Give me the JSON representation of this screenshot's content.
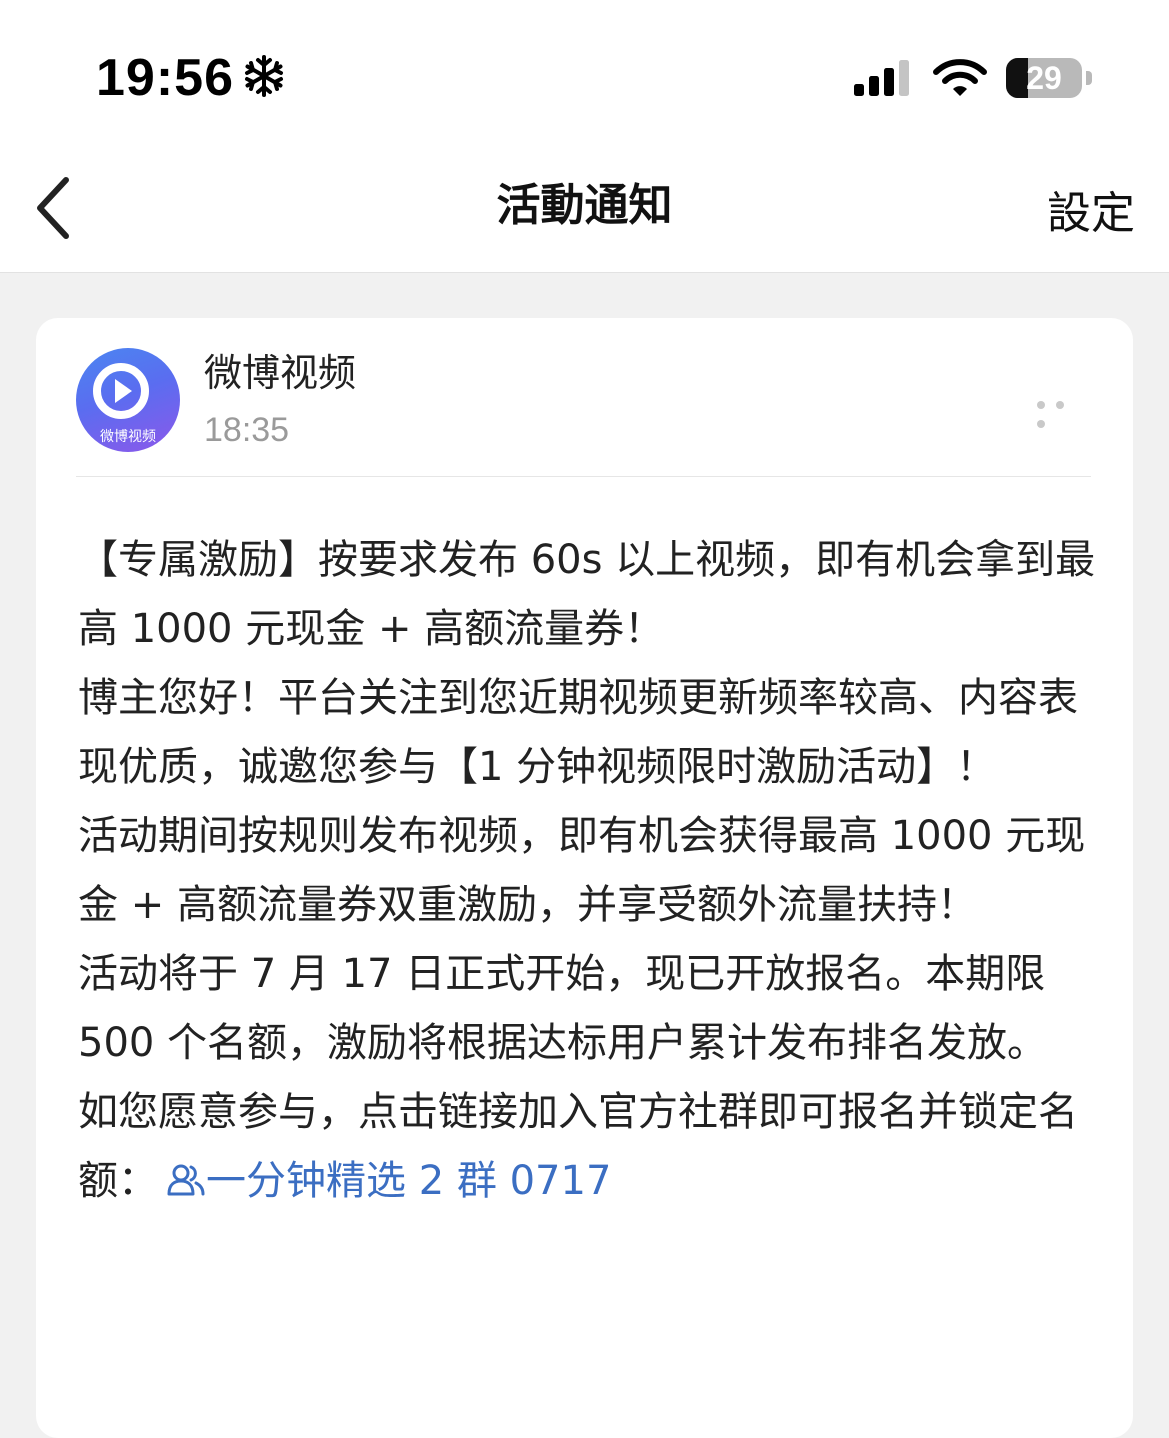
{
  "status_bar": {
    "time": "19:56",
    "battery_level": "29",
    "battery_fraction": 0.29
  },
  "nav": {
    "title": "活動通知",
    "settings_label": "設定"
  },
  "message": {
    "sender_name": "微博视频",
    "avatar_caption": "微博视频",
    "sent_time": "18:35",
    "paragraphs": [
      "【专属激励】按要求发布 60s 以上视频，即有机会拿到最高 1000 元现金 + 高额流量券！",
      "博主您好！平台关注到您近期视频更新频率较高、内容表现优质，诚邀您参与【1 分钟视频限时激励活动】！",
      "活动期间按规则发布视频，即有机会获得最高 1000 元现金 + 高额流量券双重激励，并享受额外流量扶持！",
      "活动将于 7 月 17 日正式开始，现已开放报名。本期限 500 个名额，激励将根据达标用户累计发布排名发放。"
    ],
    "signup_text": "如您愿意参与，点击链接加入官方社群即可报名并锁定名额：",
    "group_link": "一分钟精选 2 群 0717"
  },
  "icons": {
    "status": [
      "snowflake-icon",
      "signal-icon",
      "wifi-icon",
      "battery-icon"
    ],
    "nav": [
      "back-chevron-icon"
    ],
    "card": [
      "play-icon",
      "more-dots-icon",
      "group-icon"
    ]
  },
  "colors": {
    "background": "#f1f1f1",
    "card": "#ffffff",
    "link": "#3b6ec2",
    "secondary_text": "#9a9a9a"
  }
}
